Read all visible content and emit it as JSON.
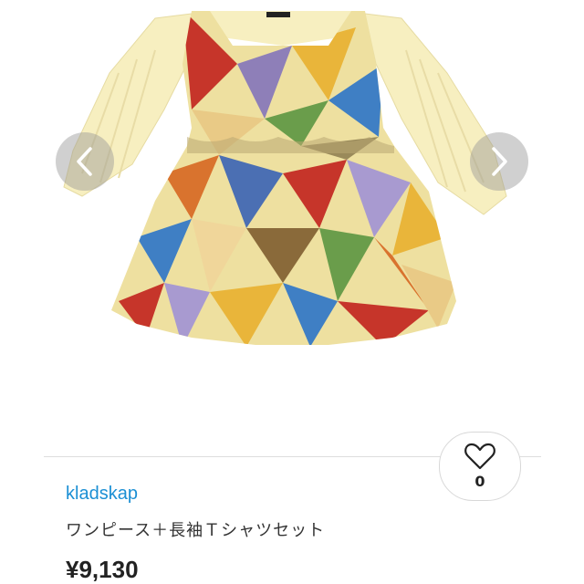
{
  "gallery": {
    "prev_icon": "chevron-left-icon",
    "next_icon": "chevron-right-icon",
    "image_subject": "patterned pinafore dress with cream ribbed long-sleeve shirt"
  },
  "like": {
    "icon": "heart-outline-icon",
    "count": "0"
  },
  "product": {
    "brand": "kladskap",
    "name": "ワンピース＋長袖Ｔシャツセット",
    "price": "¥9,130"
  },
  "colors": {
    "brand_link": "#1b8fd4",
    "shirt": "#f7efc0",
    "nav_button": "#969696"
  }
}
